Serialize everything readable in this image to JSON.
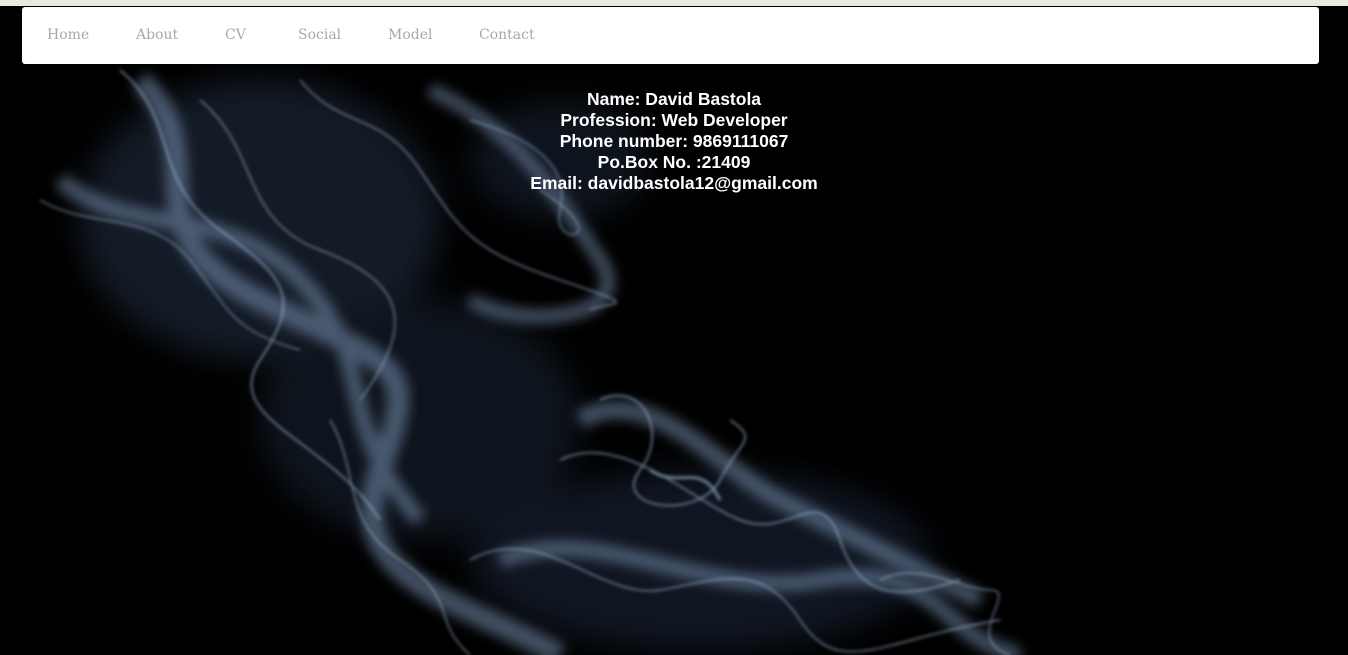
{
  "nav": {
    "items": [
      {
        "label": "Home"
      },
      {
        "label": "About"
      },
      {
        "label": "CV"
      },
      {
        "label": "Social"
      },
      {
        "label": "Model"
      },
      {
        "label": "Contact"
      }
    ]
  },
  "info": {
    "name": "Name: David Bastola",
    "profession": "Profession: Web Developer",
    "phone": "Phone number: 9869111067",
    "pobox": "Po.Box No. :21409",
    "email": "Email: davidbastola12@gmail.com"
  },
  "colors": {
    "background": "#000000",
    "navbar": "#ffffff",
    "nav_text": "#a8a8a8",
    "info_text": "#ffffff",
    "smoke": "#8ea8c8"
  }
}
